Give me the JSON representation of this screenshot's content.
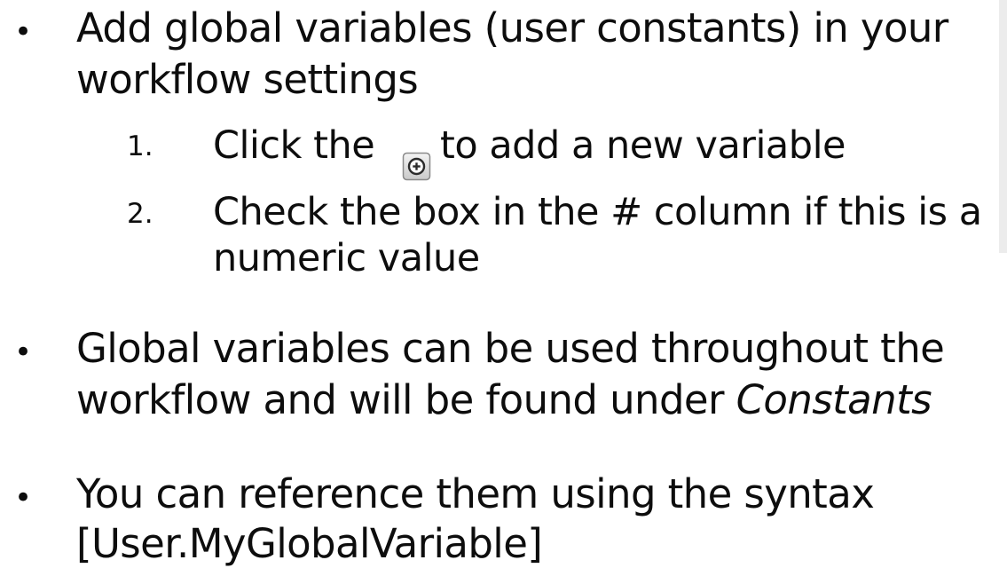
{
  "bullets": [
    {
      "marker": "•",
      "lines": [
        "Add global variables (user constants) in your",
        "workflow settings"
      ]
    },
    {
      "marker": "•",
      "line1": "Global variables can be used throughout the",
      "line2_pre": "workflow and will be found under ",
      "line2_em": "Constants"
    },
    {
      "marker": "•",
      "lines": [
        "You can reference them using the syntax",
        "[User.MyGlobalVariable]"
      ]
    }
  ],
  "steps": [
    {
      "number": "1.",
      "text_before_icon": "Click the",
      "icon": "add-circle-icon",
      "text_after_icon": "to add a new variable"
    },
    {
      "number": "2.",
      "lines": [
        "Check the box in the # column if this is a",
        "numeric value"
      ]
    }
  ]
}
